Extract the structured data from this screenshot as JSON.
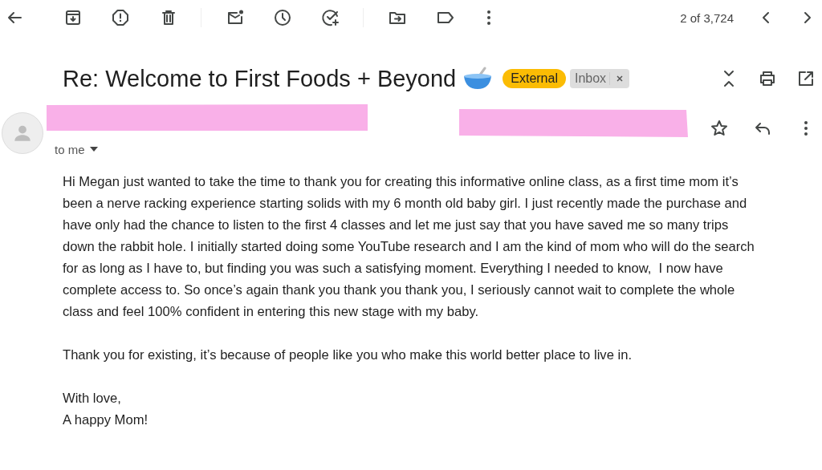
{
  "toolbar": {
    "counter": "2 of 3,724"
  },
  "message": {
    "subject": "Re: Welcome to First Foods + Beyond",
    "labels": [
      {
        "kind": "badge",
        "text": "External",
        "color": "#fbbc04",
        "removable": false
      },
      {
        "kind": "label",
        "text": "Inbox",
        "color": "#dddddd",
        "removable": true
      }
    ],
    "recipient": "to me",
    "paragraphs": [
      {
        "lines": [
          "Hi Megan just wanted to take the time to thank you for creating this informative online class, as a first time mom it’s",
          "been a nerve racking experience starting solids with my 6 month old baby girl. I just recently made the purchase and",
          "have only had the chance to listen to the first 4 classes and let me just say that you have saved me so many trips",
          "down the rabbit hole. I initially started doing some YouTube research and I am the kind of mom who will do the search",
          "for as long as I have to, but finding you was such a satisfying moment. Everything I needed to know,  I now have",
          "complete access to. So once’s again thank you thank you thank you, I seriously cannot wait to complete the whole",
          "class and feel 100% confident in entering this new stage with my baby."
        ]
      },
      {
        "lines": [
          "Thank you for existing, it’s because of people like you who make this world better place to live in."
        ]
      },
      {
        "lines": [
          "With love,",
          "A happy Mom!"
        ]
      }
    ]
  }
}
